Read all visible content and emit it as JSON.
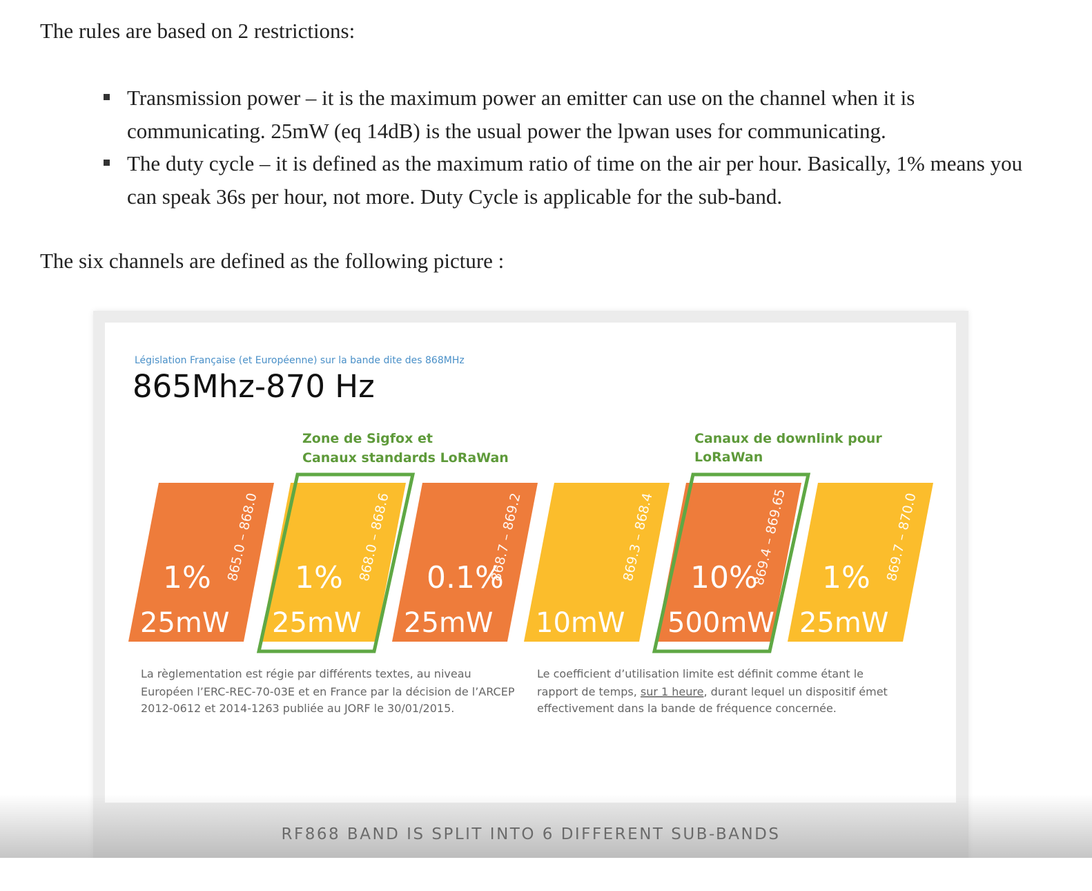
{
  "intro": "The rules are based on 2 restrictions:",
  "bullets": [
    "Transmission power – it is the maximum power an emitter can use on the channel when it is communicating. 25mW (eq 14dB) is the usual power the lpwan uses for communicating.",
    "The duty cycle – it is defined as the maximum ratio of time on the air per hour. Basically, 1% means you can speak 36s per hour, not more. Duty Cycle is applicable for the sub-band."
  ],
  "channels_intro": "The six channels are defined as the following picture :",
  "figure": {
    "subtitle": "Législation Française (et Européenne) sur la bande dite des 868MHz",
    "title": "865Mhz-870 Hz",
    "zone_sigfox": [
      "Zone de Sigfox et",
      "Canaux standards LoRaWan"
    ],
    "zone_downlink": [
      "Canaux de downlink pour",
      "LoRaWan"
    ],
    "bands": [
      {
        "range": "865.0 – 868.0",
        "duty": "1%",
        "power": "25mW",
        "color": "#ee7c3b",
        "highlighted": false
      },
      {
        "range": "868.0 – 868.6",
        "duty": "1%",
        "power": "25mW",
        "color": "#fbbd2c",
        "highlighted": true
      },
      {
        "range": "868.7 – 869.2",
        "duty": "0.1%",
        "power": "25mW",
        "color": "#ee7c3b",
        "highlighted": false
      },
      {
        "range": "869.3 – 868.4",
        "duty": "",
        "power": "10mW",
        "color": "#fbbd2c",
        "highlighted": false
      },
      {
        "range": "869.4 – 869.65",
        "duty": "10%",
        "power": "500mW",
        "color": "#ee7c3b",
        "highlighted": true
      },
      {
        "range": "869.7 – 870.0",
        "duty": "1%",
        "power": "25mW",
        "color": "#fbbd2c",
        "highlighted": false
      }
    ],
    "note_left": [
      "La règlementation est régie par différents textes, au niveau",
      "Européen l’ERC-REC-70-03E et en France par la décision de l’ARCEP",
      "2012-0612 et 2014-1263 publiée au JORF le 30/01/2015."
    ],
    "note_right": {
      "line1": "Le coefficient d’utilisation limite est définit comme étant le",
      "line2_before": "rapport de temps, ",
      "line2_link": "sur 1 heure",
      "line2_after": ", durant lequel un dispositif émet",
      "line3": "effectivement dans la bande de fréquence concernée."
    },
    "colors": {
      "orange": "#ee7c3b",
      "yellow": "#fbbd2c",
      "green": "#5fa844",
      "green_text": "#5e9a3a",
      "subtitle_blue": "#4a90c8"
    }
  },
  "caption": "RF868 BAND IS SPLIT INTO 6 DIFFERENT SUB-BANDS"
}
